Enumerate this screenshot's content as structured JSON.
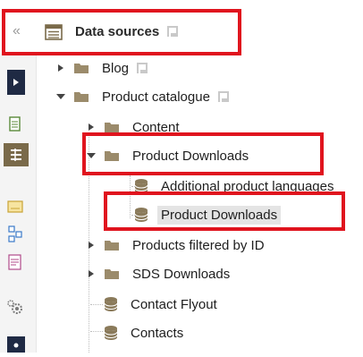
{
  "header": {
    "collapse_glyph": "«",
    "title": "Data sources"
  },
  "tree": {
    "blog": "Blog",
    "product_catalogue": "Product catalogue",
    "content": "Content",
    "product_downloads_folder": "Product Downloads",
    "additional_product_languages": "Additional product languages",
    "product_downloads_source": "Product Downloads",
    "products_filtered_by_id": "Products filtered by ID",
    "sds_downloads": "SDS Downloads",
    "contact_flyout": "Contact Flyout",
    "contacts": "Contacts"
  },
  "colors": {
    "highlight_border": "#e0141e",
    "folder": "#9b8b6b",
    "database": "#8a7a5a",
    "selected_bg": "#e4e4e4"
  },
  "icons": [
    "double-chevron-left-icon",
    "data-sources-icon",
    "flag-icon",
    "folder-icon",
    "database-icon",
    "triangle-right-icon",
    "triangle-down-icon"
  ]
}
